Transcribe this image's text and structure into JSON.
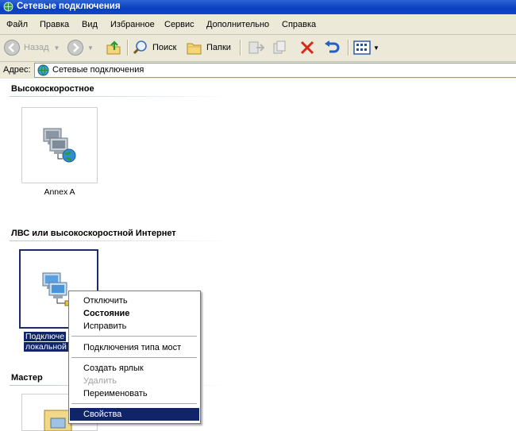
{
  "window": {
    "title": "Сетевые подключения"
  },
  "menu": [
    "Файл",
    "Правка",
    "Вид",
    "Избранное",
    "Сервис",
    "Дополнительно",
    "Справка"
  ],
  "toolbar": {
    "back": "Назад",
    "search": "Поиск",
    "folders": "Папки"
  },
  "address": {
    "label": "Адрес:",
    "value": "Сетевые подключения"
  },
  "groups": {
    "broadband": {
      "title": "Высокоскоростное",
      "item": "Annex A"
    },
    "lan": {
      "title": "ЛВС или высокоскоростной Интернет",
      "item_line1": "Подключе",
      "item_line2": "локальной"
    },
    "wizard": {
      "title": "Мастер"
    }
  },
  "context_menu": {
    "disable": "Отключить",
    "status": "Состояние",
    "repair": "Исправить",
    "bridge": "Подключения типа мост",
    "shortcut": "Создать ярлык",
    "delete": "Удалить",
    "rename": "Переименовать",
    "properties": "Свойства"
  },
  "colors": {
    "title_bar": "#0a3fbf",
    "selection": "#10246a",
    "chrome": "#ece9d8"
  }
}
